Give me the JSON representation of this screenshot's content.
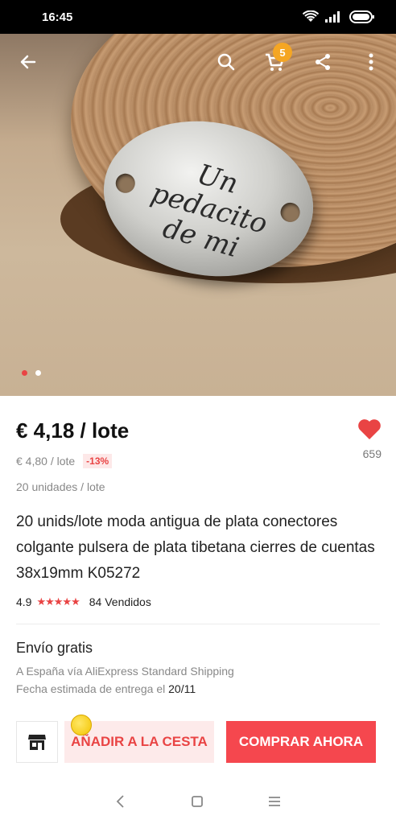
{
  "status_bar": {
    "time": "16:45",
    "icons": [
      "wifi-icon",
      "signal-icon",
      "battery-icon"
    ]
  },
  "top_bar": {
    "icons": [
      "back-arrow-icon",
      "search-icon",
      "cart-icon",
      "share-icon",
      "more-vert-icon"
    ],
    "cart_count": "5",
    "cart_badge_color": "#f5a623"
  },
  "hero": {
    "image_text": "Un pedacito de mi",
    "image_count": 2,
    "active_image_index": 0
  },
  "product": {
    "price": "€ 4,18 / lote",
    "old_price": "€ 4,80 / lote",
    "discount": "-13%",
    "likes": "659",
    "units": "20 unidades / lote",
    "title": "20 unids/lote moda antigua de plata conectores colgante pulsera de plata tibetana cierres de cuentas 38x19mm K05272",
    "rating": "4.9",
    "stars": "★★★★★",
    "sold": "84 Vendidos"
  },
  "shipping": {
    "title": "Envío gratis",
    "method": "A España vía AliExpress Standard Shipping",
    "delivery_label": "Fecha estimada de entrega el ",
    "delivery_date": "20/11"
  },
  "actions": {
    "add_to_cart": "AÑADIR A LA CESTA",
    "buy_now": "COMPRAR AHORA",
    "store_icon": "store-icon"
  },
  "nav_bar": {
    "icons": [
      "nav-back-icon",
      "nav-home-icon",
      "nav-menu-icon"
    ]
  },
  "colors": {
    "accent": "#e94444",
    "buy_button": "#f5474e",
    "add_button_bg": "#fdeaea"
  }
}
